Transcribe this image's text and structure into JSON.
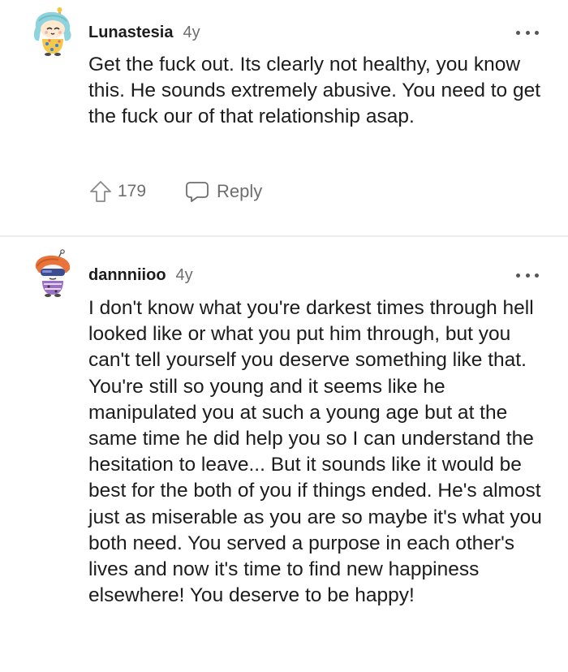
{
  "comments": [
    {
      "username": "Lunastesia",
      "age": "4y",
      "avatar_icon": "snoo-avatar-teal-hair",
      "body": "Get the fuck out. Its clearly not healthy, you know this. He sounds extremely abusive. You need to get the fuck our of that relationship asap.",
      "upvotes": "179",
      "reply_label": "Reply"
    },
    {
      "username": "dannniioo",
      "age": "4y",
      "avatar_icon": "snoo-avatar-orange-hair-visor",
      "body": "I don't know what you're darkest times through hell looked like or what you put him through, but you can't tell yourself you deserve something like that. You're still so young and it seems like he manipulated you at such a young age but at the same time he did help you so I can understand the hesitation to leave... But it sounds like it would be best for the both of you if things ended. He's almost just as miserable as you are so maybe it's what you both need. You served a purpose in each other's lives and now it's time to find new happiness elsewhere! You deserve to be happy!"
    }
  ],
  "colors": {
    "text_primary": "#1c1c1c",
    "text_secondary": "#6e6e6e",
    "divider": "#ececec"
  },
  "icons": {
    "more": "more-options-icon",
    "upvote": "upvote-arrow-icon",
    "reply": "speech-bubble-icon"
  }
}
